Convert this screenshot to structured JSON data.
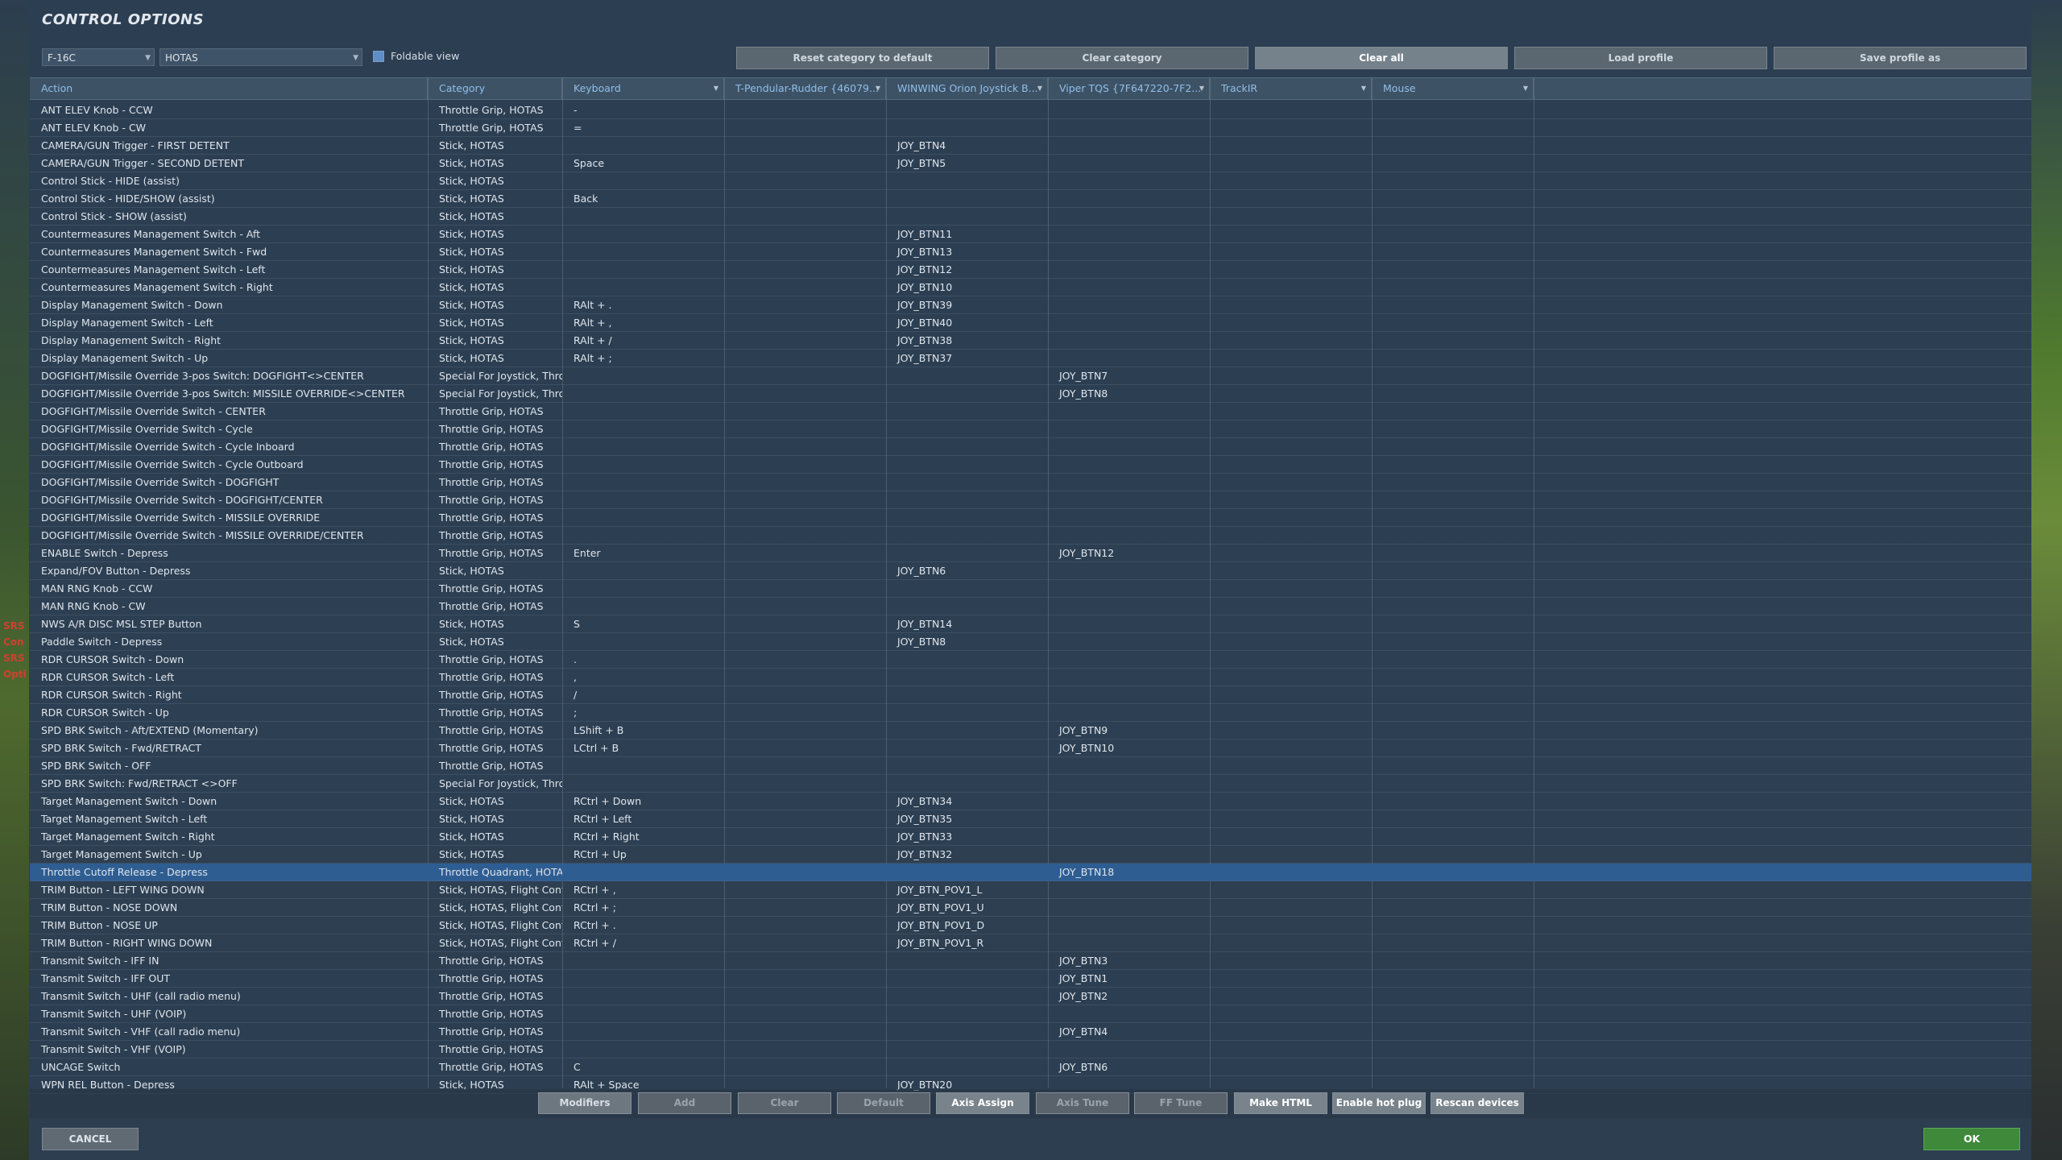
{
  "title": "CONTROL OPTIONS",
  "aircraft_select": "F-16C",
  "category_select": "HOTAS",
  "foldable_view_label": "Foldable view",
  "top_buttons": [
    "Reset category to default",
    "Clear category",
    "Clear all",
    "Load profile",
    "Save profile as"
  ],
  "columns": [
    "Action",
    "Category",
    "Keyboard",
    "T-Pendular-Rudder {46079...",
    "WINWING Orion Joystick B...",
    "Viper TQS {7F647220-7F2...",
    "TrackIR",
    "Mouse"
  ],
  "side_labels": [
    "SRS",
    "Con",
    "SRS",
    "Opti"
  ],
  "rows": [
    {
      "action": "ANT ELEV Knob - CCW",
      "category": "Throttle Grip, HOTAS",
      "keyboard": "-",
      "rudder": "",
      "joystick": "",
      "tqs": ""
    },
    {
      "action": "ANT ELEV Knob - CW",
      "category": "Throttle Grip, HOTAS",
      "keyboard": "=",
      "rudder": "",
      "joystick": "",
      "tqs": ""
    },
    {
      "action": "CAMERA/GUN Trigger - FIRST DETENT",
      "category": "Stick, HOTAS",
      "keyboard": "",
      "rudder": "",
      "joystick": "JOY_BTN4",
      "tqs": ""
    },
    {
      "action": "CAMERA/GUN Trigger - SECOND DETENT",
      "category": "Stick, HOTAS",
      "keyboard": "Space",
      "rudder": "",
      "joystick": "JOY_BTN5",
      "tqs": ""
    },
    {
      "action": "Control Stick - HIDE (assist)",
      "category": "Stick, HOTAS",
      "keyboard": "",
      "rudder": "",
      "joystick": "",
      "tqs": ""
    },
    {
      "action": "Control Stick - HIDE/SHOW (assist)",
      "category": "Stick, HOTAS",
      "keyboard": "Back",
      "rudder": "",
      "joystick": "",
      "tqs": ""
    },
    {
      "action": "Control Stick - SHOW (assist)",
      "category": "Stick, HOTAS",
      "keyboard": "",
      "rudder": "",
      "joystick": "",
      "tqs": ""
    },
    {
      "action": "Countermeasures Management Switch - Aft",
      "category": "Stick, HOTAS",
      "keyboard": "",
      "rudder": "",
      "joystick": "JOY_BTN11",
      "tqs": ""
    },
    {
      "action": "Countermeasures Management Switch - Fwd",
      "category": "Stick, HOTAS",
      "keyboard": "",
      "rudder": "",
      "joystick": "JOY_BTN13",
      "tqs": ""
    },
    {
      "action": "Countermeasures Management Switch - Left",
      "category": "Stick, HOTAS",
      "keyboard": "",
      "rudder": "",
      "joystick": "JOY_BTN12",
      "tqs": ""
    },
    {
      "action": "Countermeasures Management Switch - Right",
      "category": "Stick, HOTAS",
      "keyboard": "",
      "rudder": "",
      "joystick": "JOY_BTN10",
      "tqs": ""
    },
    {
      "action": "Display Management Switch - Down",
      "category": "Stick, HOTAS",
      "keyboard": "RAlt + .",
      "rudder": "",
      "joystick": "JOY_BTN39",
      "tqs": ""
    },
    {
      "action": "Display Management Switch - Left",
      "category": "Stick, HOTAS",
      "keyboard": "RAlt + ,",
      "rudder": "",
      "joystick": "JOY_BTN40",
      "tqs": ""
    },
    {
      "action": "Display Management Switch - Right",
      "category": "Stick, HOTAS",
      "keyboard": "RAlt + /",
      "rudder": "",
      "joystick": "JOY_BTN38",
      "tqs": ""
    },
    {
      "action": "Display Management Switch - Up",
      "category": "Stick, HOTAS",
      "keyboard": "RAlt + ;",
      "rudder": "",
      "joystick": "JOY_BTN37",
      "tqs": ""
    },
    {
      "action": "DOGFIGHT/Missile Override 3-pos Switch: DOGFIGHT<>CENTER",
      "category": "Special For Joystick, Throt",
      "keyboard": "",
      "rudder": "",
      "joystick": "",
      "tqs": "JOY_BTN7"
    },
    {
      "action": "DOGFIGHT/Missile Override 3-pos Switch: MISSILE OVERRIDE<>CENTER",
      "category": "Special For Joystick, Throt",
      "keyboard": "",
      "rudder": "",
      "joystick": "",
      "tqs": "JOY_BTN8"
    },
    {
      "action": "DOGFIGHT/Missile Override Switch - CENTER",
      "category": "Throttle Grip, HOTAS",
      "keyboard": "",
      "rudder": "",
      "joystick": "",
      "tqs": ""
    },
    {
      "action": "DOGFIGHT/Missile Override Switch - Cycle",
      "category": "Throttle Grip, HOTAS",
      "keyboard": "",
      "rudder": "",
      "joystick": "",
      "tqs": ""
    },
    {
      "action": "DOGFIGHT/Missile Override Switch - Cycle Inboard",
      "category": "Throttle Grip, HOTAS",
      "keyboard": "",
      "rudder": "",
      "joystick": "",
      "tqs": ""
    },
    {
      "action": "DOGFIGHT/Missile Override Switch - Cycle Outboard",
      "category": "Throttle Grip, HOTAS",
      "keyboard": "",
      "rudder": "",
      "joystick": "",
      "tqs": ""
    },
    {
      "action": "DOGFIGHT/Missile Override Switch - DOGFIGHT",
      "category": "Throttle Grip, HOTAS",
      "keyboard": "",
      "rudder": "",
      "joystick": "",
      "tqs": ""
    },
    {
      "action": "DOGFIGHT/Missile Override Switch - DOGFIGHT/CENTER",
      "category": "Throttle Grip, HOTAS",
      "keyboard": "",
      "rudder": "",
      "joystick": "",
      "tqs": ""
    },
    {
      "action": "DOGFIGHT/Missile Override Switch - MISSILE OVERRIDE",
      "category": "Throttle Grip, HOTAS",
      "keyboard": "",
      "rudder": "",
      "joystick": "",
      "tqs": ""
    },
    {
      "action": "DOGFIGHT/Missile Override Switch - MISSILE OVERRIDE/CENTER",
      "category": "Throttle Grip, HOTAS",
      "keyboard": "",
      "rudder": "",
      "joystick": "",
      "tqs": ""
    },
    {
      "action": "ENABLE Switch - Depress",
      "category": "Throttle Grip, HOTAS",
      "keyboard": "Enter",
      "rudder": "",
      "joystick": "",
      "tqs": "JOY_BTN12"
    },
    {
      "action": "Expand/FOV Button - Depress",
      "category": "Stick, HOTAS",
      "keyboard": "",
      "rudder": "",
      "joystick": "JOY_BTN6",
      "tqs": ""
    },
    {
      "action": "MAN RNG Knob - CCW",
      "category": "Throttle Grip, HOTAS",
      "keyboard": "",
      "rudder": "",
      "joystick": "",
      "tqs": ""
    },
    {
      "action": "MAN RNG Knob - CW",
      "category": "Throttle Grip, HOTAS",
      "keyboard": "",
      "rudder": "",
      "joystick": "",
      "tqs": ""
    },
    {
      "action": "NWS A/R DISC MSL STEP Button",
      "category": "Stick, HOTAS",
      "keyboard": "S",
      "rudder": "",
      "joystick": "JOY_BTN14",
      "tqs": ""
    },
    {
      "action": "Paddle Switch - Depress",
      "category": "Stick, HOTAS",
      "keyboard": "",
      "rudder": "",
      "joystick": "JOY_BTN8",
      "tqs": ""
    },
    {
      "action": "RDR CURSOR Switch - Down",
      "category": "Throttle Grip, HOTAS",
      "keyboard": ".",
      "rudder": "",
      "joystick": "",
      "tqs": ""
    },
    {
      "action": "RDR CURSOR Switch - Left",
      "category": "Throttle Grip, HOTAS",
      "keyboard": ",",
      "rudder": "",
      "joystick": "",
      "tqs": ""
    },
    {
      "action": "RDR CURSOR Switch - Right",
      "category": "Throttle Grip, HOTAS",
      "keyboard": "/",
      "rudder": "",
      "joystick": "",
      "tqs": ""
    },
    {
      "action": "RDR CURSOR Switch - Up",
      "category": "Throttle Grip, HOTAS",
      "keyboard": ";",
      "rudder": "",
      "joystick": "",
      "tqs": ""
    },
    {
      "action": "SPD BRK Switch - Aft/EXTEND (Momentary)",
      "category": "Throttle Grip, HOTAS",
      "keyboard": "LShift + B",
      "rudder": "",
      "joystick": "",
      "tqs": "JOY_BTN9"
    },
    {
      "action": "SPD BRK Switch - Fwd/RETRACT",
      "category": "Throttle Grip, HOTAS",
      "keyboard": "LCtrl + B",
      "rudder": "",
      "joystick": "",
      "tqs": "JOY_BTN10"
    },
    {
      "action": "SPD BRK Switch - OFF",
      "category": "Throttle Grip, HOTAS",
      "keyboard": "",
      "rudder": "",
      "joystick": "",
      "tqs": ""
    },
    {
      "action": "SPD BRK Switch: Fwd/RETRACT <>OFF",
      "category": "Special For Joystick, Throt",
      "keyboard": "",
      "rudder": "",
      "joystick": "",
      "tqs": ""
    },
    {
      "action": "Target Management Switch - Down",
      "category": "Stick, HOTAS",
      "keyboard": "RCtrl + Down",
      "rudder": "",
      "joystick": "JOY_BTN34",
      "tqs": ""
    },
    {
      "action": "Target Management Switch - Left",
      "category": "Stick, HOTAS",
      "keyboard": "RCtrl + Left",
      "rudder": "",
      "joystick": "JOY_BTN35",
      "tqs": ""
    },
    {
      "action": "Target Management Switch - Right",
      "category": "Stick, HOTAS",
      "keyboard": "RCtrl + Right",
      "rudder": "",
      "joystick": "JOY_BTN33",
      "tqs": ""
    },
    {
      "action": "Target Management Switch - Up",
      "category": "Stick, HOTAS",
      "keyboard": "RCtrl + Up",
      "rudder": "",
      "joystick": "JOY_BTN32",
      "tqs": ""
    },
    {
      "action": "Throttle Cutoff Release - Depress",
      "category": "Throttle Quadrant, HOTAS",
      "keyboard": "",
      "rudder": "",
      "joystick": "",
      "tqs": "JOY_BTN18",
      "selected": true
    },
    {
      "action": "TRIM Button - LEFT WING DOWN",
      "category": "Stick, HOTAS, Flight Contr",
      "keyboard": "RCtrl + ,",
      "rudder": "",
      "joystick": "JOY_BTN_POV1_L",
      "tqs": ""
    },
    {
      "action": "TRIM Button - NOSE DOWN",
      "category": "Stick, HOTAS, Flight Contr",
      "keyboard": "RCtrl + ;",
      "rudder": "",
      "joystick": "JOY_BTN_POV1_U",
      "tqs": ""
    },
    {
      "action": "TRIM Button - NOSE UP",
      "category": "Stick, HOTAS, Flight Contr",
      "keyboard": "RCtrl + .",
      "rudder": "",
      "joystick": "JOY_BTN_POV1_D",
      "tqs": ""
    },
    {
      "action": "TRIM Button - RIGHT WING DOWN",
      "category": "Stick, HOTAS, Flight Contr",
      "keyboard": "RCtrl + /",
      "rudder": "",
      "joystick": "JOY_BTN_POV1_R",
      "tqs": ""
    },
    {
      "action": "Transmit Switch - IFF IN",
      "category": "Throttle Grip, HOTAS",
      "keyboard": "",
      "rudder": "",
      "joystick": "",
      "tqs": "JOY_BTN3"
    },
    {
      "action": "Transmit Switch - IFF OUT",
      "category": "Throttle Grip, HOTAS",
      "keyboard": "",
      "rudder": "",
      "joystick": "",
      "tqs": "JOY_BTN1"
    },
    {
      "action": "Transmit Switch - UHF (call radio menu)",
      "category": "Throttle Grip, HOTAS",
      "keyboard": "",
      "rudder": "",
      "joystick": "",
      "tqs": "JOY_BTN2"
    },
    {
      "action": "Transmit Switch - UHF (VOIP)",
      "category": "Throttle Grip, HOTAS",
      "keyboard": "",
      "rudder": "",
      "joystick": "",
      "tqs": ""
    },
    {
      "action": "Transmit Switch - VHF (call radio menu)",
      "category": "Throttle Grip, HOTAS",
      "keyboard": "",
      "rudder": "",
      "joystick": "",
      "tqs": "JOY_BTN4"
    },
    {
      "action": "Transmit Switch - VHF (VOIP)",
      "category": "Throttle Grip, HOTAS",
      "keyboard": "",
      "rudder": "",
      "joystick": "",
      "tqs": ""
    },
    {
      "action": "UNCAGE Switch",
      "category": "Throttle Grip, HOTAS",
      "keyboard": "C",
      "rudder": "",
      "joystick": "",
      "tqs": "JOY_BTN6"
    },
    {
      "action": "WPN REL Button - Depress",
      "category": "Stick, HOTAS",
      "keyboard": "RAlt + Space",
      "rudder": "",
      "joystick": "JOY_BTN20",
      "tqs": ""
    }
  ],
  "bottom_buttons": [
    {
      "label": "Modifiers",
      "state": "normal"
    },
    {
      "label": "Add",
      "state": "dim"
    },
    {
      "label": "Clear",
      "state": "dim"
    },
    {
      "label": "Default",
      "state": "dim"
    },
    {
      "label": "Axis Assign",
      "state": "on"
    },
    {
      "label": "Axis Tune",
      "state": "dim"
    },
    {
      "label": "FF Tune",
      "state": "dim"
    },
    {
      "label": "Make HTML",
      "state": "on"
    },
    {
      "label": "Enable hot plug",
      "state": "on"
    },
    {
      "label": "Rescan devices",
      "state": "on"
    }
  ],
  "cancel_label": "CANCEL",
  "ok_label": "OK",
  "colors": {
    "accent": "#8fbfea",
    "selected_row": "#2e5d92",
    "ok_button": "#3f8a3a"
  }
}
